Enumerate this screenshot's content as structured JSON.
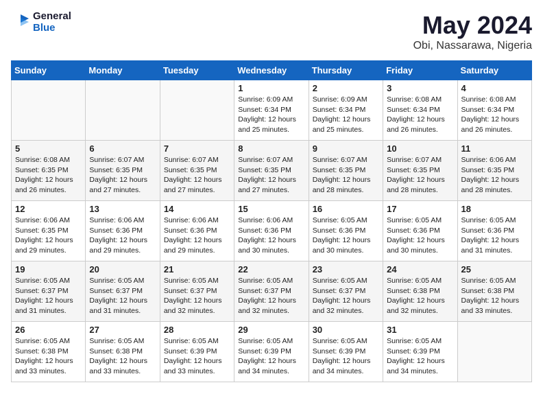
{
  "logo": {
    "line1": "General",
    "line2": "Blue"
  },
  "title": "May 2024",
  "subtitle": "Obi, Nassarawa, Nigeria",
  "days_of_week": [
    "Sunday",
    "Monday",
    "Tuesday",
    "Wednesday",
    "Thursday",
    "Friday",
    "Saturday"
  ],
  "weeks": [
    [
      {
        "day": "",
        "info": ""
      },
      {
        "day": "",
        "info": ""
      },
      {
        "day": "",
        "info": ""
      },
      {
        "day": "1",
        "info": "Sunrise: 6:09 AM\nSunset: 6:34 PM\nDaylight: 12 hours\nand 25 minutes."
      },
      {
        "day": "2",
        "info": "Sunrise: 6:09 AM\nSunset: 6:34 PM\nDaylight: 12 hours\nand 25 minutes."
      },
      {
        "day": "3",
        "info": "Sunrise: 6:08 AM\nSunset: 6:34 PM\nDaylight: 12 hours\nand 26 minutes."
      },
      {
        "day": "4",
        "info": "Sunrise: 6:08 AM\nSunset: 6:34 PM\nDaylight: 12 hours\nand 26 minutes."
      }
    ],
    [
      {
        "day": "5",
        "info": "Sunrise: 6:08 AM\nSunset: 6:35 PM\nDaylight: 12 hours\nand 26 minutes."
      },
      {
        "day": "6",
        "info": "Sunrise: 6:07 AM\nSunset: 6:35 PM\nDaylight: 12 hours\nand 27 minutes."
      },
      {
        "day": "7",
        "info": "Sunrise: 6:07 AM\nSunset: 6:35 PM\nDaylight: 12 hours\nand 27 minutes."
      },
      {
        "day": "8",
        "info": "Sunrise: 6:07 AM\nSunset: 6:35 PM\nDaylight: 12 hours\nand 27 minutes."
      },
      {
        "day": "9",
        "info": "Sunrise: 6:07 AM\nSunset: 6:35 PM\nDaylight: 12 hours\nand 28 minutes."
      },
      {
        "day": "10",
        "info": "Sunrise: 6:07 AM\nSunset: 6:35 PM\nDaylight: 12 hours\nand 28 minutes."
      },
      {
        "day": "11",
        "info": "Sunrise: 6:06 AM\nSunset: 6:35 PM\nDaylight: 12 hours\nand 28 minutes."
      }
    ],
    [
      {
        "day": "12",
        "info": "Sunrise: 6:06 AM\nSunset: 6:35 PM\nDaylight: 12 hours\nand 29 minutes."
      },
      {
        "day": "13",
        "info": "Sunrise: 6:06 AM\nSunset: 6:36 PM\nDaylight: 12 hours\nand 29 minutes."
      },
      {
        "day": "14",
        "info": "Sunrise: 6:06 AM\nSunset: 6:36 PM\nDaylight: 12 hours\nand 29 minutes."
      },
      {
        "day": "15",
        "info": "Sunrise: 6:06 AM\nSunset: 6:36 PM\nDaylight: 12 hours\nand 30 minutes."
      },
      {
        "day": "16",
        "info": "Sunrise: 6:05 AM\nSunset: 6:36 PM\nDaylight: 12 hours\nand 30 minutes."
      },
      {
        "day": "17",
        "info": "Sunrise: 6:05 AM\nSunset: 6:36 PM\nDaylight: 12 hours\nand 30 minutes."
      },
      {
        "day": "18",
        "info": "Sunrise: 6:05 AM\nSunset: 6:36 PM\nDaylight: 12 hours\nand 31 minutes."
      }
    ],
    [
      {
        "day": "19",
        "info": "Sunrise: 6:05 AM\nSunset: 6:37 PM\nDaylight: 12 hours\nand 31 minutes."
      },
      {
        "day": "20",
        "info": "Sunrise: 6:05 AM\nSunset: 6:37 PM\nDaylight: 12 hours\nand 31 minutes."
      },
      {
        "day": "21",
        "info": "Sunrise: 6:05 AM\nSunset: 6:37 PM\nDaylight: 12 hours\nand 32 minutes."
      },
      {
        "day": "22",
        "info": "Sunrise: 6:05 AM\nSunset: 6:37 PM\nDaylight: 12 hours\nand 32 minutes."
      },
      {
        "day": "23",
        "info": "Sunrise: 6:05 AM\nSunset: 6:37 PM\nDaylight: 12 hours\nand 32 minutes."
      },
      {
        "day": "24",
        "info": "Sunrise: 6:05 AM\nSunset: 6:38 PM\nDaylight: 12 hours\nand 32 minutes."
      },
      {
        "day": "25",
        "info": "Sunrise: 6:05 AM\nSunset: 6:38 PM\nDaylight: 12 hours\nand 33 minutes."
      }
    ],
    [
      {
        "day": "26",
        "info": "Sunrise: 6:05 AM\nSunset: 6:38 PM\nDaylight: 12 hours\nand 33 minutes."
      },
      {
        "day": "27",
        "info": "Sunrise: 6:05 AM\nSunset: 6:38 PM\nDaylight: 12 hours\nand 33 minutes."
      },
      {
        "day": "28",
        "info": "Sunrise: 6:05 AM\nSunset: 6:39 PM\nDaylight: 12 hours\nand 33 minutes."
      },
      {
        "day": "29",
        "info": "Sunrise: 6:05 AM\nSunset: 6:39 PM\nDaylight: 12 hours\nand 34 minutes."
      },
      {
        "day": "30",
        "info": "Sunrise: 6:05 AM\nSunset: 6:39 PM\nDaylight: 12 hours\nand 34 minutes."
      },
      {
        "day": "31",
        "info": "Sunrise: 6:05 AM\nSunset: 6:39 PM\nDaylight: 12 hours\nand 34 minutes."
      },
      {
        "day": "",
        "info": ""
      }
    ]
  ]
}
